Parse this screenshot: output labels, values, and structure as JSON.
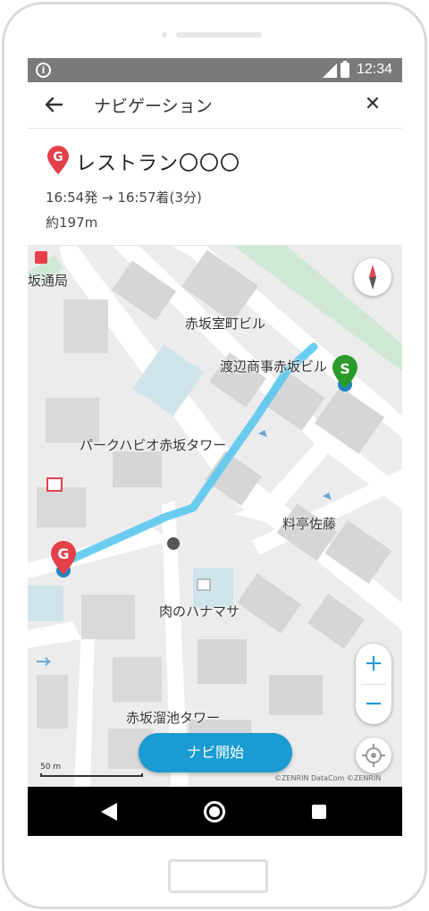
{
  "status": {
    "time": "12:34"
  },
  "appbar": {
    "title": "ナビゲーション",
    "close_glyph": "✕"
  },
  "destination": {
    "pin_letter": "G",
    "name": "レストラン〇〇〇",
    "timeline": "16:54発 → 16:57着(3分)",
    "distance": "約197m"
  },
  "map": {
    "labels": {
      "akasaka_post": "坂通局",
      "akasaka_muromachi": "赤坂室町ビル",
      "watanabe": "渡辺商事赤坂ビル",
      "park_habio": "パークハビオ赤坂タワー",
      "ryotei_sato": "料亭佐藤",
      "niku_hanamasa": "肉のハナマサ",
      "akasaka_tameike": "赤坂溜池タワー"
    },
    "start_pin_letter": "S",
    "goal_pin_letter": "G",
    "zoom_in": "+",
    "zoom_out": "−",
    "scale_label": "50 m",
    "copyright": "©ZENRIN DataCom ©ZENRIN",
    "route_color": "#5bc8ee",
    "start_color": "#2a9a2a",
    "goal_color": "#e5404a",
    "user_dot_color": "#1c86c4"
  },
  "navi_button": {
    "label": "ナビ開始"
  }
}
